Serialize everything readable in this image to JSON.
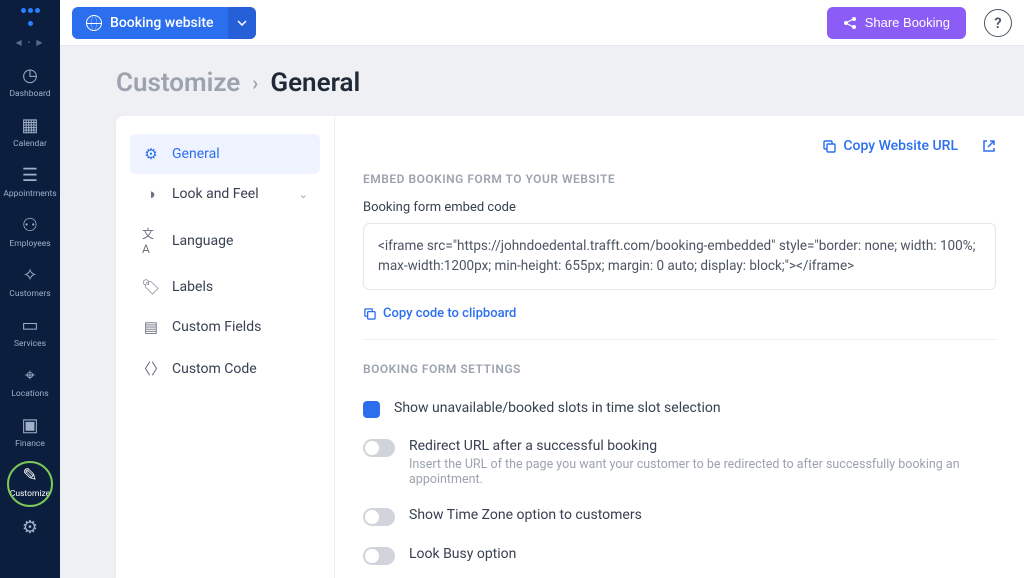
{
  "topbar": {
    "dropdown_label": "Booking website",
    "share_label": "Share Booking"
  },
  "breadcrumb": {
    "root": "Customize",
    "current": "General"
  },
  "sidebar": {
    "items": [
      {
        "label": "Dashboard"
      },
      {
        "label": "Calendar"
      },
      {
        "label": "Appointments"
      },
      {
        "label": "Employees"
      },
      {
        "label": "Customers"
      },
      {
        "label": "Services"
      },
      {
        "label": "Locations"
      },
      {
        "label": "Finance"
      },
      {
        "label": "Customize"
      }
    ]
  },
  "settings_nav": {
    "items": [
      {
        "label": "General"
      },
      {
        "label": "Look and Feel"
      },
      {
        "label": "Language"
      },
      {
        "label": "Labels"
      },
      {
        "label": "Custom Fields"
      },
      {
        "label": "Custom Code"
      }
    ]
  },
  "body": {
    "copy_url_label": "Copy Website URL",
    "section1_title": "EMBED BOOKING FORM TO YOUR WEBSITE",
    "embed_label": "Booking form embed code",
    "embed_code": "<iframe src=\"https://johndoedental.trafft.com/booking-embedded\" style=\"border: none; width: 100%; max-width:1200px; min-height: 655px; margin: 0 auto; display: block;\"></iframe>",
    "copy_code_label": "Copy code to clipboard",
    "section2_title": "BOOKING FORM SETTINGS",
    "settings": [
      {
        "label": "Show unavailable/booked slots in time slot selection"
      },
      {
        "label": "Redirect URL after a successful booking",
        "desc": "Insert the URL of the page you want your customer to be redirected to after successfully booking an appointment."
      },
      {
        "label": "Show Time Zone option to customers"
      },
      {
        "label": "Look Busy option"
      }
    ]
  }
}
